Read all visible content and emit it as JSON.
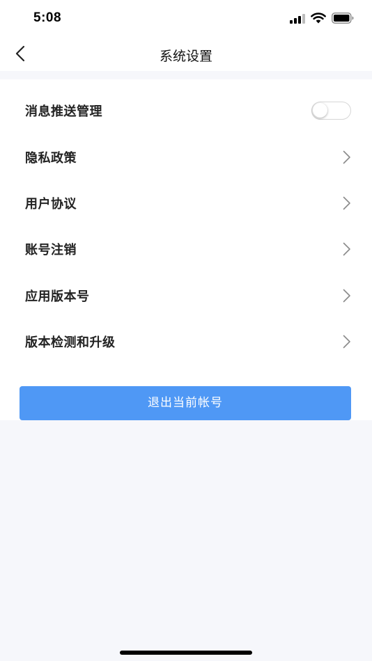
{
  "status_bar": {
    "time": "5:08",
    "signal_icon": "signal-bars-icon",
    "wifi_icon": "wifi-icon",
    "battery_icon": "battery-icon"
  },
  "nav": {
    "back_icon": "chevron-left-icon",
    "title": "系统设置"
  },
  "settings": {
    "items": [
      {
        "label": "消息推送管理",
        "control": "toggle",
        "toggle_on": false
      },
      {
        "label": "隐私政策",
        "control": "chevron"
      },
      {
        "label": "用户协议",
        "control": "chevron"
      },
      {
        "label": "账号注销",
        "control": "chevron"
      },
      {
        "label": "应用版本号",
        "control": "chevron"
      },
      {
        "label": "版本检测和升级",
        "control": "chevron"
      }
    ]
  },
  "logout": {
    "label": "退出当前帐号"
  },
  "colors": {
    "accent": "#4f98f5",
    "page_background": "#f6f7fb",
    "card_background": "#ffffff"
  }
}
